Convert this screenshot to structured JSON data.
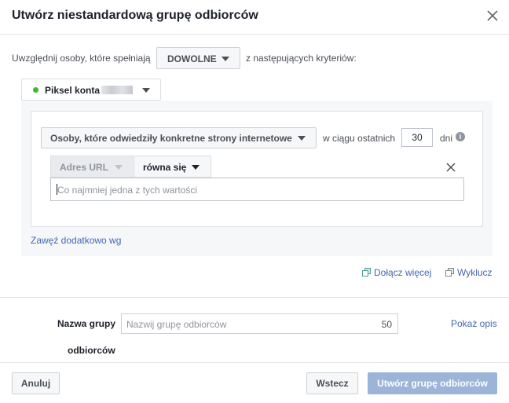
{
  "dialog": {
    "title": "Utwórz niestandardową grupę odbiorców"
  },
  "include": {
    "prefix": "Uwzględnij osoby, które spełniają",
    "mode": "DOWOLNE",
    "suffix": "z następujących kryteriów:"
  },
  "source": {
    "label": "Piksel konta"
  },
  "rule": {
    "event": "Osoby, które odwiedziły konkretne strony internetowe",
    "within_label": "w ciągu ostatnich",
    "days": "30",
    "days_label": "dni",
    "condition": {
      "field": "Adres URL",
      "operator": "równa się",
      "placeholder": "Co najmniej jedna z tych wartości"
    }
  },
  "narrow_link": "Zawęź dodatkowo wg",
  "actions": {
    "include_more": "Dołącz więcej",
    "exclude": "Wyklucz"
  },
  "name": {
    "label_line1": "Nazwa grupy",
    "label_line2": "odbiorców",
    "placeholder": "Nazwij grupę odbiorców",
    "char_limit": "50",
    "show_description": "Pokaż opis"
  },
  "footer": {
    "cancel": "Anuluj",
    "back": "Wstecz",
    "create": "Utwórz grupę odbiorców"
  },
  "colors": {
    "link": "#4267b2",
    "primary_disabled": "#9cb4d8",
    "status_green": "#42b72a"
  }
}
